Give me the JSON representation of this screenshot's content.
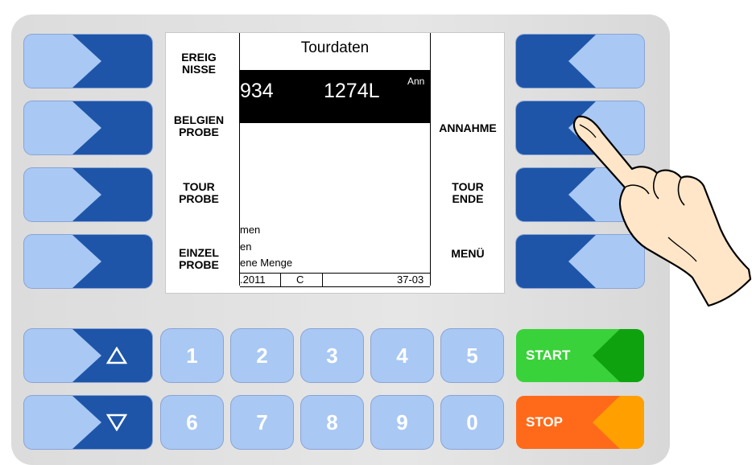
{
  "display": {
    "title": "Tourdaten",
    "left_labels": [
      [
        "EREIG",
        "NISSE"
      ],
      [
        "BELGIEN",
        "PROBE"
      ],
      [
        "TOUR",
        "PROBE"
      ],
      [
        "EINZEL",
        "PROBE"
      ]
    ],
    "right_labels": [
      [
        "ANNAHME"
      ],
      [
        "TOUR",
        "ENDE"
      ],
      [
        "MENÜ"
      ]
    ],
    "bar": {
      "left_number": "934",
      "amount": "1274L",
      "tag": "Ann"
    },
    "lines": [
      "men",
      "en",
      "ene Menge"
    ],
    "status": {
      "date": ".2011",
      "code": "C",
      "ref": "37-03"
    }
  },
  "keypad": {
    "row1": [
      "1",
      "2",
      "3",
      "4",
      "5"
    ],
    "row2": [
      "6",
      "7",
      "8",
      "9",
      "0"
    ],
    "up_icon": "triangle-up-icon",
    "down_icon": "triangle-down-icon"
  },
  "controls": {
    "start_label": "START",
    "stop_label": "STOP",
    "start_color": "#3ad23a",
    "start_notch": "#0fa20f",
    "stop_color": "#ff6a1a",
    "stop_notch": "#ffa000"
  },
  "colors": {
    "key_dark": "#1e55a8",
    "key_light": "#a9c8f4"
  }
}
